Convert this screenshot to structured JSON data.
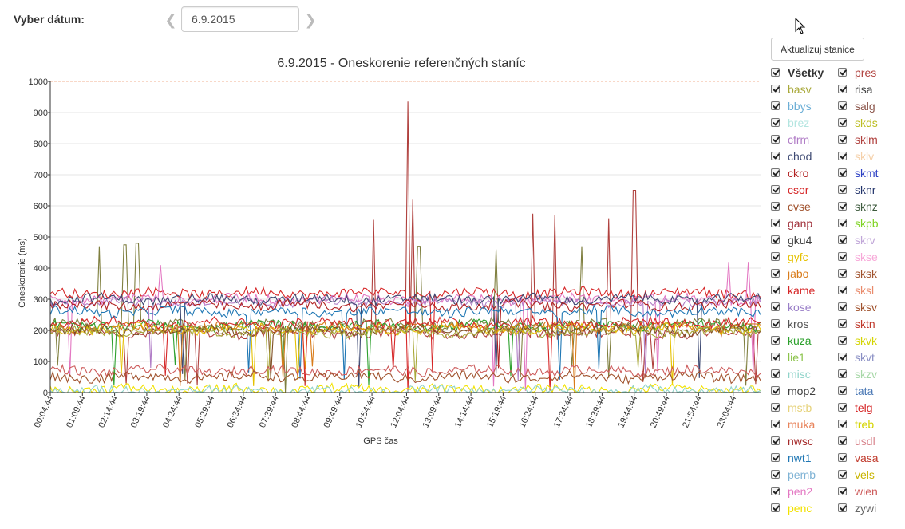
{
  "controls": {
    "date_label": "Vyber dátum:",
    "date_value": "6.9.2015",
    "prev_icon": "chevron-left-icon",
    "next_icon": "chevron-right-icon",
    "update_button": "Aktualizuj stanice"
  },
  "chart_data": {
    "type": "line",
    "title": "6.9.2015 - Oneskorenie referenčných staníc",
    "xlabel": "GPS čas",
    "ylabel": "Oneskorenie (ms)",
    "ylim": [
      0,
      1000
    ],
    "yticks": [
      "0",
      "100",
      "200",
      "300",
      "400",
      "500",
      "600",
      "700",
      "800",
      "900",
      "1000"
    ],
    "xticks": [
      "00:04:44",
      "01:09:44",
      "02:14:44",
      "03:19:44",
      "04:24:44",
      "05:29:44",
      "06:34:44",
      "07:39:44",
      "08:44:44",
      "09:49:44",
      "10:54:44",
      "12:04:44",
      "13:09:44",
      "14:14:44",
      "15:19:44",
      "16:24:44",
      "17:34:44",
      "18:39:44",
      "19:44:44",
      "20:49:44",
      "21:54:44",
      "23:04:44"
    ],
    "grid": true,
    "legend_placement": "right",
    "series": [
      {
        "name": "pres",
        "color": "#b0413e",
        "base": 190,
        "spikes": [
          [
            12.15,
            935
          ],
          [
            12.3,
            620
          ],
          [
            16.3,
            575
          ],
          [
            17.05,
            570
          ],
          [
            19.75,
            650
          ],
          [
            18.9,
            560
          ],
          [
            10.95,
            555
          ]
        ]
      },
      {
        "name": "mop2",
        "color": "#7f7f3f",
        "base": 220,
        "spikes": [
          [
            1.75,
            470
          ],
          [
            2.6,
            475
          ],
          [
            3.0,
            480
          ],
          [
            12.5,
            470
          ],
          [
            15.1,
            460
          ],
          [
            18.0,
            470
          ]
        ]
      },
      {
        "name": "kame",
        "color": "#d62728",
        "base": 320
      },
      {
        "name": "pen2",
        "color": "#e377c2",
        "base": 300,
        "spikes": [
          [
            3.8,
            410
          ],
          [
            22.95,
            420
          ],
          [
            23.6,
            420
          ]
        ]
      },
      {
        "name": "cfrm",
        "color": "#b07cc6",
        "base": 290
      },
      {
        "name": "chod",
        "color": "#3e4a73",
        "base": 300
      },
      {
        "name": "ckro",
        "color": "#b22222",
        "base": 280
      },
      {
        "name": "nwt1",
        "color": "#1f77b4",
        "base": 260
      },
      {
        "name": "kuza",
        "color": "#2ca02c",
        "base": 215
      },
      {
        "name": "gyfc",
        "color": "#e5c100",
        "base": 205
      },
      {
        "name": "jabo",
        "color": "#d97c1a",
        "base": 210
      },
      {
        "name": "csor",
        "color": "#d62728",
        "base": 225
      },
      {
        "name": "kros",
        "color": "#7f4f24",
        "base": 200
      },
      {
        "name": "basv",
        "color": "#a9a93a",
        "base": 195
      },
      {
        "name": "wien",
        "color": "#cd5c5c",
        "base": 70
      },
      {
        "name": "sksv",
        "color": "#a0522d",
        "base": 50
      },
      {
        "name": "penc",
        "color": "#f2e200",
        "base": 10
      },
      {
        "name": "misc",
        "color": "#8fd3c9",
        "base": 5
      }
    ]
  },
  "legend": {
    "col1": [
      {
        "label": "Všetky",
        "color": "#333333",
        "bold": true
      },
      {
        "label": "basv",
        "color": "#a9a93a"
      },
      {
        "label": "bbys",
        "color": "#6baed6"
      },
      {
        "label": "brez",
        "color": "#b3e5e0"
      },
      {
        "label": "cfrm",
        "color": "#b07cc6"
      },
      {
        "label": "chod",
        "color": "#3e4a73"
      },
      {
        "label": "ckro",
        "color": "#b22222"
      },
      {
        "label": "csor",
        "color": "#d62728"
      },
      {
        "label": "cvse",
        "color": "#a0522d"
      },
      {
        "label": "ganp",
        "color": "#a0303a"
      },
      {
        "label": "gku4",
        "color": "#3f3f3f"
      },
      {
        "label": "gyfc",
        "color": "#e5c100"
      },
      {
        "label": "jabo",
        "color": "#d97c1a"
      },
      {
        "label": "kame",
        "color": "#d62728"
      },
      {
        "label": "kose",
        "color": "#9a7fc8"
      },
      {
        "label": "kros",
        "color": "#555555"
      },
      {
        "label": "kuza",
        "color": "#2ca02c"
      },
      {
        "label": "lie1",
        "color": "#8bc34a"
      },
      {
        "label": "misc",
        "color": "#8fd3c9"
      },
      {
        "label": "mop2",
        "color": "#3f3f3f"
      },
      {
        "label": "mstb",
        "color": "#e6d27a"
      },
      {
        "label": "muka",
        "color": "#e8845c"
      },
      {
        "label": "nwsc",
        "color": "#a52a2a"
      },
      {
        "label": "nwt1",
        "color": "#1f77b4"
      },
      {
        "label": "pemb",
        "color": "#7fb3d5"
      },
      {
        "label": "pen2",
        "color": "#e377c2"
      },
      {
        "label": "penc",
        "color": "#f2e200"
      }
    ],
    "col2": [
      {
        "label": "pres",
        "color": "#b0413e"
      },
      {
        "label": "risa",
        "color": "#444444"
      },
      {
        "label": "salg",
        "color": "#8c564b"
      },
      {
        "label": "skds",
        "color": "#bcbd22"
      },
      {
        "label": "sklm",
        "color": "#b0413e"
      },
      {
        "label": "sklv",
        "color": "#f5d0a9"
      },
      {
        "label": "skmt",
        "color": "#2b3fc4"
      },
      {
        "label": "sknr",
        "color": "#23346b"
      },
      {
        "label": "sknz",
        "color": "#3d5a3d"
      },
      {
        "label": "skpb",
        "color": "#7ed321"
      },
      {
        "label": "skrv",
        "color": "#c0a6d8"
      },
      {
        "label": "skse",
        "color": "#f7a8d8"
      },
      {
        "label": "sksk",
        "color": "#a0522d"
      },
      {
        "label": "sksl",
        "color": "#e98a6b"
      },
      {
        "label": "sksv",
        "color": "#a0522d"
      },
      {
        "label": "sktn",
        "color": "#c0392b"
      },
      {
        "label": "skvk",
        "color": "#d4d400"
      },
      {
        "label": "skvt",
        "color": "#8a8fc4"
      },
      {
        "label": "skzv",
        "color": "#a8d8a8"
      },
      {
        "label": "tata",
        "color": "#4a78b5"
      },
      {
        "label": "telg",
        "color": "#d62728"
      },
      {
        "label": "treb",
        "color": "#d4d400"
      },
      {
        "label": "usdl",
        "color": "#d9868e"
      },
      {
        "label": "vasa",
        "color": "#c0392b"
      },
      {
        "label": "vels",
        "color": "#c8b400"
      },
      {
        "label": "wien",
        "color": "#cd5c5c"
      },
      {
        "label": "zywi",
        "color": "#666666"
      }
    ]
  }
}
